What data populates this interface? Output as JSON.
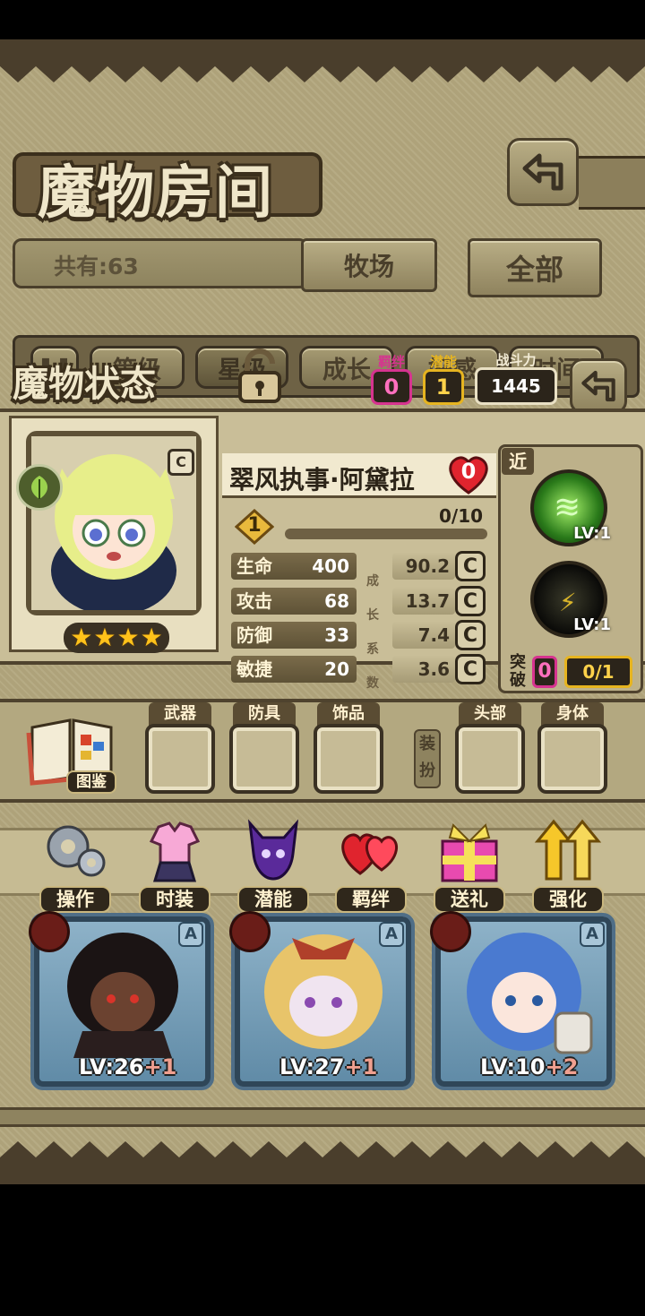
{
  "header": {
    "title": "魔物房间",
    "back_icon": "back-arrow-icon"
  },
  "collection": {
    "total_label": "共有:63",
    "tabs": [
      {
        "label": "牧场"
      },
      {
        "label": "全部"
      }
    ]
  },
  "sort_bar": {
    "toggle_icon": "pause-icon",
    "options": [
      {
        "label": "等级"
      },
      {
        "label": "星级",
        "selected": true
      },
      {
        "label": "成长"
      },
      {
        "label": "好感"
      },
      {
        "label": "时间"
      }
    ]
  },
  "status_panel": {
    "title": "魔物状态",
    "lock_icon": "padlock-icon",
    "bond": {
      "label": "羁绊",
      "value": "0"
    },
    "potential": {
      "label": "潜能",
      "value": "1"
    },
    "power": {
      "label": "战斗力",
      "value": "1445"
    },
    "monster": {
      "name": "翠风执事·阿黛拉",
      "affection": "0",
      "element_icon": "leaf-element-icon",
      "stars": 4,
      "level": "1",
      "exp": "0/10",
      "exp_fraction": 0.0
    },
    "stats": [
      {
        "name": "生命",
        "value": "400",
        "growth": "90.2",
        "rank": "C"
      },
      {
        "name": "攻击",
        "value": "68",
        "growth": "13.7",
        "rank": "C"
      },
      {
        "name": "防御",
        "value": "33",
        "growth": "7.4",
        "rank": "C"
      },
      {
        "name": "敏捷",
        "value": "20",
        "growth": "3.6",
        "rank": "C"
      }
    ],
    "growth_label": [
      "成",
      "长",
      "系",
      "数"
    ],
    "attack_type": "近",
    "skills": [
      {
        "name": "wind-skill-icon",
        "level": "LV:1"
      },
      {
        "name": "dark-skill-icon",
        "level": "LV:1"
      }
    ],
    "breakthrough": {
      "label1": "突",
      "label2": "破",
      "value": "0",
      "progress": "0/1"
    }
  },
  "equipment": {
    "codex_label": "图鉴",
    "slots": [
      {
        "label": "武器"
      },
      {
        "label": "防具"
      },
      {
        "label": "饰品"
      },
      {
        "label": "头部"
      },
      {
        "label": "身体"
      }
    ],
    "equip_label": [
      "装",
      "扮"
    ]
  },
  "actions": [
    {
      "label": "操作",
      "icon": "gear-icon"
    },
    {
      "label": "时装",
      "icon": "outfit-icon"
    },
    {
      "label": "潜能",
      "icon": "potential-demon-icon"
    },
    {
      "label": "羁绊",
      "icon": "hearts-icon"
    },
    {
      "label": "送礼",
      "icon": "gift-icon"
    },
    {
      "label": "强化",
      "icon": "upgrade-arrows-icon"
    }
  ],
  "monster_cards": [
    {
      "level": "LV:26",
      "bonus": "+1",
      "rank": "A"
    },
    {
      "level": "LV:27",
      "bonus": "+1",
      "rank": "A"
    },
    {
      "level": "LV:10",
      "bonus": "+2",
      "rank": "A"
    }
  ],
  "colors": {
    "accent_pink": "#d6338f",
    "accent_gold": "#e6b420",
    "parchment": "#ada279"
  }
}
